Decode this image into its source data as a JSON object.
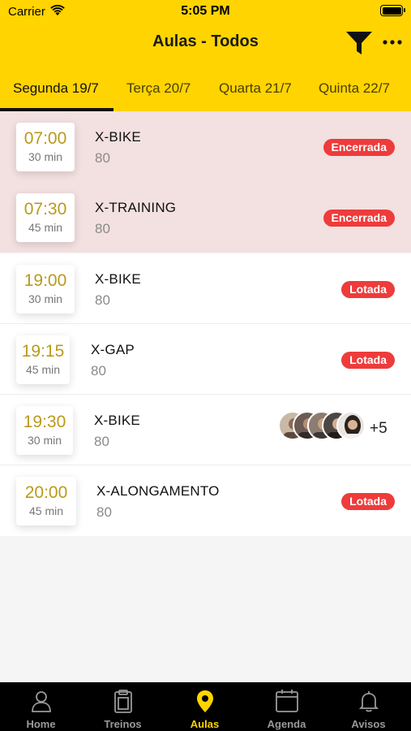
{
  "status_bar": {
    "carrier": "Carrier",
    "time": "5:05 PM",
    "wifi_icon": "wifi-icon",
    "battery_icon": "battery-icon"
  },
  "nav": {
    "title": "Aulas - Todos",
    "filter_icon": "filter-icon",
    "more_icon": "more-icon"
  },
  "day_tabs": [
    {
      "label": "Segunda 19/7",
      "active": true
    },
    {
      "label": "Terça 20/7",
      "active": false
    },
    {
      "label": "Quarta 21/7",
      "active": false
    },
    {
      "label": "Quinta 22/7",
      "active": false
    }
  ],
  "classes": [
    {
      "time": "07:00",
      "duration": "30 min",
      "name": "X-BIKE",
      "capacity": "80",
      "status": "Encerrada"
    },
    {
      "time": "07:30",
      "duration": "45 min",
      "name": "X-TRAINING",
      "capacity": "80",
      "status": "Encerrada"
    },
    {
      "time": "19:00",
      "duration": "30 min",
      "name": "X-BIKE",
      "capacity": "80",
      "status": "Lotada"
    },
    {
      "time": "19:15",
      "duration": "45 min",
      "name": "X-GAP",
      "capacity": "80",
      "status": "Lotada"
    },
    {
      "time": "19:30",
      "duration": "30 min",
      "name": "X-BIKE",
      "capacity": "80",
      "status": "",
      "participants_more": "+5"
    },
    {
      "time": "20:00",
      "duration": "45 min",
      "name": "X-ALONGAMENTO",
      "capacity": "80",
      "status": "Lotada"
    }
  ],
  "tabbar": [
    {
      "label": "Home",
      "icon": "person-icon",
      "active": false
    },
    {
      "label": "Treinos",
      "icon": "clipboard-icon",
      "active": false
    },
    {
      "label": "Aulas",
      "icon": "location-pin-icon",
      "active": true
    },
    {
      "label": "Agenda",
      "icon": "calendar-icon",
      "active": false
    },
    {
      "label": "Avisos",
      "icon": "bell-icon",
      "active": false
    }
  ],
  "colors": {
    "brand": "#ffd400",
    "time_text": "#b99a1a",
    "badge": "#ee3b3b",
    "closed_row": "#f3e0e0"
  }
}
